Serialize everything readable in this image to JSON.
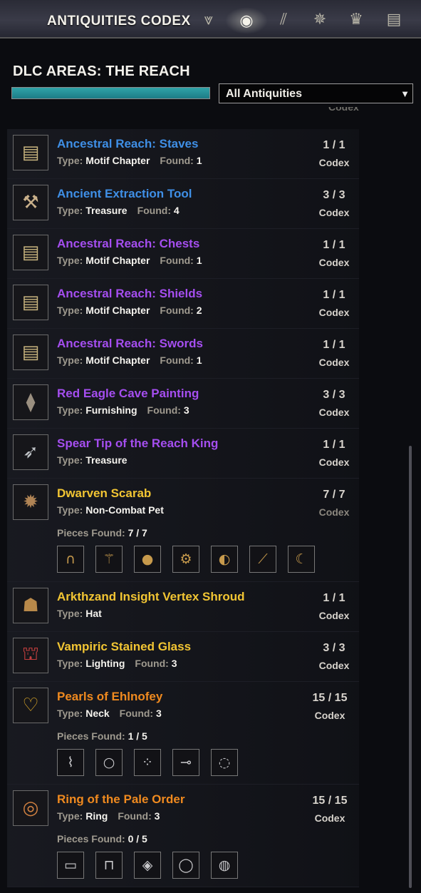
{
  "app": {
    "title": "ANTIQUITIES CODEX"
  },
  "tabs": [
    {
      "name": "lead-tab",
      "glyph": "⩔"
    },
    {
      "name": "codex-tab",
      "glyph": "◉"
    },
    {
      "name": "journal-tab",
      "glyph": "⫽"
    },
    {
      "name": "compass-tab",
      "glyph": "✵"
    },
    {
      "name": "trophy-tab",
      "glyph": "♛"
    },
    {
      "name": "book-tab",
      "glyph": "▤"
    }
  ],
  "header": {
    "title": "DLC AREAS: THE REACH",
    "progress_fraction": 1.0,
    "filter": {
      "selected": "All Antiquities"
    }
  },
  "partial_text": "Codex",
  "colors": {
    "blue": "#3f8fe6",
    "purple": "#a54ef0",
    "gold": "#f2c533",
    "orange": "#f08a1f"
  },
  "labels": {
    "type": "Type:",
    "found": "Found:",
    "codex": "Codex",
    "pieces_found": "Pieces Found:"
  },
  "entries": [
    {
      "name": "Ancestral Reach: Staves",
      "quality": "blue",
      "icon": "scroll-icon",
      "type": "Motif Chapter",
      "found": "1",
      "count": "1 / 1"
    },
    {
      "name": "Ancient Extraction Tool",
      "quality": "blue",
      "icon": "tool-icon",
      "type": "Treasure",
      "found": "4",
      "count": "3 / 3"
    },
    {
      "name": "Ancestral Reach: Chests",
      "quality": "purple",
      "icon": "scroll-icon",
      "type": "Motif Chapter",
      "found": "1",
      "count": "1 / 1"
    },
    {
      "name": "Ancestral Reach: Shields",
      "quality": "purple",
      "icon": "scroll-icon",
      "type": "Motif Chapter",
      "found": "2",
      "count": "1 / 1"
    },
    {
      "name": "Ancestral Reach: Swords",
      "quality": "purple",
      "icon": "scroll-icon",
      "type": "Motif Chapter",
      "found": "1",
      "count": "1 / 1"
    },
    {
      "name": "Red Eagle Cave Painting",
      "quality": "purple",
      "icon": "stone-icon",
      "type": "Furnishing",
      "found": "3",
      "count": "3 / 3"
    },
    {
      "name": "Spear Tip of the Reach King",
      "quality": "purple",
      "icon": "spear-tip-icon",
      "type": "Treasure",
      "found": "",
      "count": "1 / 1"
    },
    {
      "name": "Dwarven Scarab",
      "quality": "gold",
      "icon": "scarab-icon",
      "type": "Non-Combat Pet",
      "found": "",
      "count": "7 / 7",
      "pieces_found": "7 / 7",
      "codex_dim": true,
      "pieces": [
        "coil-piece-icon",
        "staff-piece-icon",
        "dome-piece-icon",
        "gear-piece-icon",
        "wing-piece-icon",
        "leg-piece-icon",
        "claw-piece-icon"
      ]
    },
    {
      "name": "Arkthzand Insight Vertex Shroud",
      "quality": "gold",
      "icon": "helm-icon",
      "type": "Hat",
      "found": "",
      "count": "1 / 1"
    },
    {
      "name": "Vampiric Stained Glass",
      "quality": "gold",
      "icon": "stained-glass-icon",
      "type": "Lighting",
      "found": "3",
      "count": "3 / 3"
    },
    {
      "name": "Pearls of Ehlnofey",
      "quality": "orange",
      "icon": "necklace-icon",
      "type": "Neck",
      "found": "3",
      "count": "15 / 15",
      "pieces_found": "1 / 5",
      "pieces": [
        "chain-piece-icon",
        "pearl-piece-icon",
        "beads-piece-icon",
        "clasp-piece-icon",
        "strand-piece-icon"
      ]
    },
    {
      "name": "Ring of the Pale Order",
      "quality": "orange",
      "icon": "ring-icon",
      "type": "Ring",
      "found": "3",
      "count": "15 / 15",
      "pieces_found": "0 / 5",
      "pieces": [
        "band-piece-icon",
        "setting-piece-icon",
        "stone-piece-icon",
        "hoop-piece-icon",
        "signet-piece-icon"
      ]
    }
  ]
}
